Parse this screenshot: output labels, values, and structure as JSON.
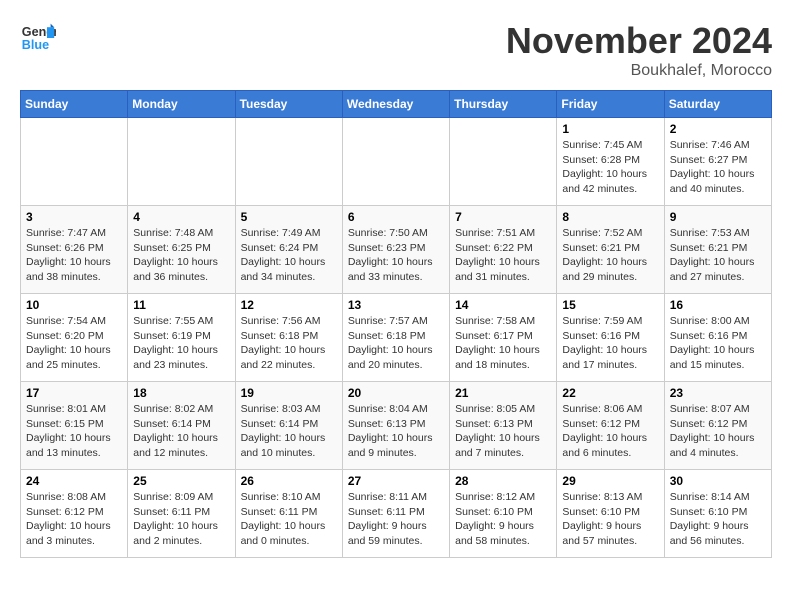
{
  "header": {
    "logo_general": "General",
    "logo_blue": "Blue",
    "month_title": "November 2024",
    "location": "Boukhalef, Morocco"
  },
  "days_of_week": [
    "Sunday",
    "Monday",
    "Tuesday",
    "Wednesday",
    "Thursday",
    "Friday",
    "Saturday"
  ],
  "weeks": [
    [
      {
        "day": "",
        "info": ""
      },
      {
        "day": "",
        "info": ""
      },
      {
        "day": "",
        "info": ""
      },
      {
        "day": "",
        "info": ""
      },
      {
        "day": "",
        "info": ""
      },
      {
        "day": "1",
        "info": "Sunrise: 7:45 AM\nSunset: 6:28 PM\nDaylight: 10 hours\nand 42 minutes."
      },
      {
        "day": "2",
        "info": "Sunrise: 7:46 AM\nSunset: 6:27 PM\nDaylight: 10 hours\nand 40 minutes."
      }
    ],
    [
      {
        "day": "3",
        "info": "Sunrise: 7:47 AM\nSunset: 6:26 PM\nDaylight: 10 hours\nand 38 minutes."
      },
      {
        "day": "4",
        "info": "Sunrise: 7:48 AM\nSunset: 6:25 PM\nDaylight: 10 hours\nand 36 minutes."
      },
      {
        "day": "5",
        "info": "Sunrise: 7:49 AM\nSunset: 6:24 PM\nDaylight: 10 hours\nand 34 minutes."
      },
      {
        "day": "6",
        "info": "Sunrise: 7:50 AM\nSunset: 6:23 PM\nDaylight: 10 hours\nand 33 minutes."
      },
      {
        "day": "7",
        "info": "Sunrise: 7:51 AM\nSunset: 6:22 PM\nDaylight: 10 hours\nand 31 minutes."
      },
      {
        "day": "8",
        "info": "Sunrise: 7:52 AM\nSunset: 6:21 PM\nDaylight: 10 hours\nand 29 minutes."
      },
      {
        "day": "9",
        "info": "Sunrise: 7:53 AM\nSunset: 6:21 PM\nDaylight: 10 hours\nand 27 minutes."
      }
    ],
    [
      {
        "day": "10",
        "info": "Sunrise: 7:54 AM\nSunset: 6:20 PM\nDaylight: 10 hours\nand 25 minutes."
      },
      {
        "day": "11",
        "info": "Sunrise: 7:55 AM\nSunset: 6:19 PM\nDaylight: 10 hours\nand 23 minutes."
      },
      {
        "day": "12",
        "info": "Sunrise: 7:56 AM\nSunset: 6:18 PM\nDaylight: 10 hours\nand 22 minutes."
      },
      {
        "day": "13",
        "info": "Sunrise: 7:57 AM\nSunset: 6:18 PM\nDaylight: 10 hours\nand 20 minutes."
      },
      {
        "day": "14",
        "info": "Sunrise: 7:58 AM\nSunset: 6:17 PM\nDaylight: 10 hours\nand 18 minutes."
      },
      {
        "day": "15",
        "info": "Sunrise: 7:59 AM\nSunset: 6:16 PM\nDaylight: 10 hours\nand 17 minutes."
      },
      {
        "day": "16",
        "info": "Sunrise: 8:00 AM\nSunset: 6:16 PM\nDaylight: 10 hours\nand 15 minutes."
      }
    ],
    [
      {
        "day": "17",
        "info": "Sunrise: 8:01 AM\nSunset: 6:15 PM\nDaylight: 10 hours\nand 13 minutes."
      },
      {
        "day": "18",
        "info": "Sunrise: 8:02 AM\nSunset: 6:14 PM\nDaylight: 10 hours\nand 12 minutes."
      },
      {
        "day": "19",
        "info": "Sunrise: 8:03 AM\nSunset: 6:14 PM\nDaylight: 10 hours\nand 10 minutes."
      },
      {
        "day": "20",
        "info": "Sunrise: 8:04 AM\nSunset: 6:13 PM\nDaylight: 10 hours\nand 9 minutes."
      },
      {
        "day": "21",
        "info": "Sunrise: 8:05 AM\nSunset: 6:13 PM\nDaylight: 10 hours\nand 7 minutes."
      },
      {
        "day": "22",
        "info": "Sunrise: 8:06 AM\nSunset: 6:12 PM\nDaylight: 10 hours\nand 6 minutes."
      },
      {
        "day": "23",
        "info": "Sunrise: 8:07 AM\nSunset: 6:12 PM\nDaylight: 10 hours\nand 4 minutes."
      }
    ],
    [
      {
        "day": "24",
        "info": "Sunrise: 8:08 AM\nSunset: 6:12 PM\nDaylight: 10 hours\nand 3 minutes."
      },
      {
        "day": "25",
        "info": "Sunrise: 8:09 AM\nSunset: 6:11 PM\nDaylight: 10 hours\nand 2 minutes."
      },
      {
        "day": "26",
        "info": "Sunrise: 8:10 AM\nSunset: 6:11 PM\nDaylight: 10 hours\nand 0 minutes."
      },
      {
        "day": "27",
        "info": "Sunrise: 8:11 AM\nSunset: 6:11 PM\nDaylight: 9 hours\nand 59 minutes."
      },
      {
        "day": "28",
        "info": "Sunrise: 8:12 AM\nSunset: 6:10 PM\nDaylight: 9 hours\nand 58 minutes."
      },
      {
        "day": "29",
        "info": "Sunrise: 8:13 AM\nSunset: 6:10 PM\nDaylight: 9 hours\nand 57 minutes."
      },
      {
        "day": "30",
        "info": "Sunrise: 8:14 AM\nSunset: 6:10 PM\nDaylight: 9 hours\nand 56 minutes."
      }
    ]
  ]
}
